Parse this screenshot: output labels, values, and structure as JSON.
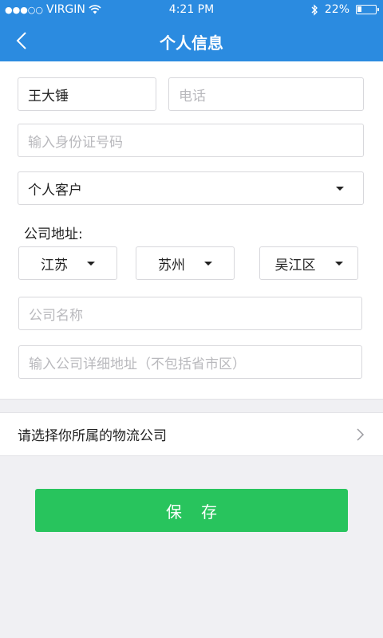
{
  "status": {
    "carrier": "VIRGIN",
    "time": "4:21 PM",
    "battery_text": "22%",
    "battery_level": 0.22,
    "icons": [
      "signal-dots-icon",
      "wifi-icon",
      "bluetooth-icon",
      "battery-icon"
    ]
  },
  "nav": {
    "title": "个人信息",
    "back_icon": "chevron-left-icon"
  },
  "form": {
    "name_value": "王大锤",
    "phone_placeholder": "电话",
    "id_placeholder": "输入身份证号码",
    "customer_type": "个人客户",
    "address_label": "公司地址:",
    "province": "江苏",
    "city": "苏州",
    "district": "吴江区",
    "company_placeholder": "公司名称",
    "detail_address_placeholder": "输入公司详细地址（不包括省市区）"
  },
  "logistics": {
    "label": "请选择你所属的物流公司",
    "icon": "chevron-right-icon"
  },
  "actions": {
    "save_label": "保存"
  },
  "colors": {
    "header": "#2b8be0",
    "save_button": "#28c45d",
    "page_bg": "#f0f0f3"
  }
}
